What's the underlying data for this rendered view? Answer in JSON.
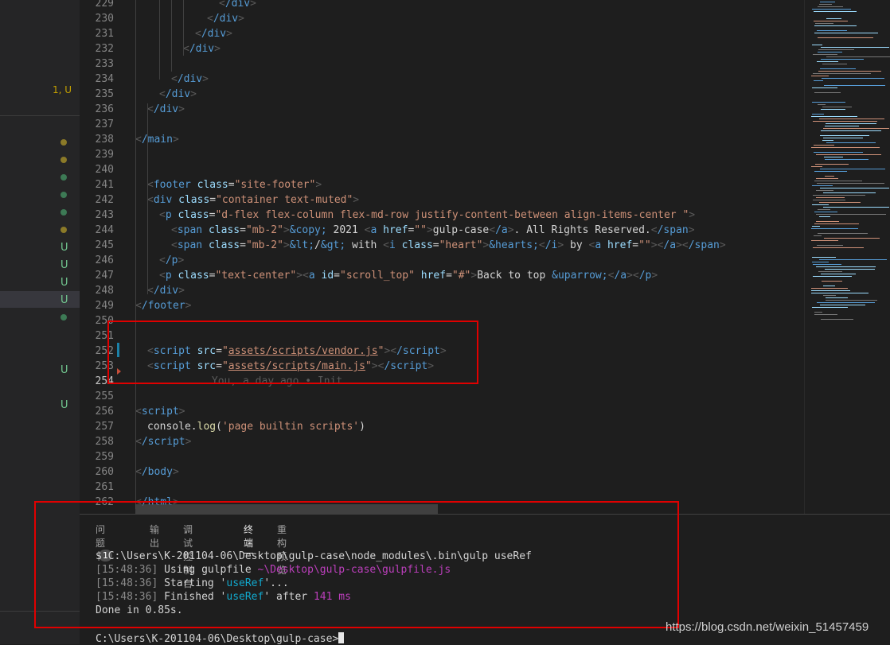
{
  "sidebar": {
    "badge": "1, U",
    "markers": [
      "U",
      "U",
      "U",
      "U",
      "U",
      "U"
    ]
  },
  "editor": {
    "blame_text": "You, a day ago • Init",
    "lines": [
      {
        "n": "229",
        "html": "<span class='g'>&lt;</span><span class='t'>/div</span><span class='g'>&gt;</span>"
      },
      {
        "n": "230",
        "html": ""
      },
      {
        "n": "231",
        "html": ""
      },
      {
        "n": "232",
        "html": ""
      },
      {
        "n": "233",
        "html": ""
      }
    ]
  },
  "panel": {
    "tabs": [
      {
        "label": "问题",
        "count": "1"
      },
      {
        "label": "输出"
      },
      {
        "label": "调试控制台"
      },
      {
        "label": "终端"
      },
      {
        "label": "重构预览"
      }
    ],
    "terminal": {
      "cmd_line": "$ C:\\Users\\K-201104-06\\Desktop\\gulp-case\\node_modules\\.bin\\gulp useRef",
      "ts1": "[15:48:36]",
      "using": " Using gulpfile ",
      "gulpfile_path": "~\\Desktop\\gulp-case\\gulpfile.js",
      "ts2": "[15:48:36]",
      "starting": " Starting '",
      "task": "useRef",
      "starting_end": "'...",
      "ts3": "[15:48:36]",
      "finished": " Finished '",
      "finished_mid": "' after ",
      "duration": "141 ms",
      "done": "Done in 0.85s.",
      "prompt": "C:\\Users\\K-201104-06\\Desktop\\gulp-case>"
    }
  },
  "watermark": "https://blog.csdn.net/weixin_51457459",
  "colors": {
    "accent_red_box": "#e00000",
    "tag_blue": "#569cd6",
    "attr_blue": "#9cdcfe",
    "string": "#ce9178"
  }
}
